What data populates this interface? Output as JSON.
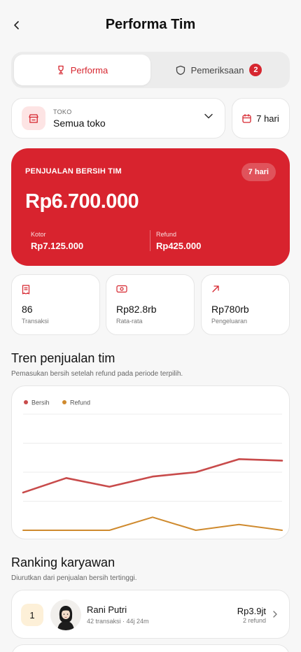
{
  "header": {
    "title": "Performa Tim"
  },
  "tabs": [
    {
      "label": "Performa",
      "icon": "trophy-icon",
      "active": true
    },
    {
      "label": "Pemeriksaan",
      "icon": "shield-icon",
      "badge": "2",
      "active": false
    }
  ],
  "filters": {
    "store_caption": "TOKO",
    "store_value": "Semua toko",
    "period": "7 hari"
  },
  "summary": {
    "label": "PENJUALAN BERSIH TIM",
    "period_pill": "7 hari",
    "net_amount": "Rp6.700.000",
    "gross_caption": "Kotor",
    "gross_value": "Rp7.125.000",
    "refund_caption": "Refund",
    "refund_value": "Rp425.000",
    "accent": "#d8232e"
  },
  "stats": [
    {
      "icon": "receipt-icon",
      "value": "86",
      "caption": "Transaksi"
    },
    {
      "icon": "cash-icon",
      "value": "Rp82.8rb",
      "caption": "Rata-rata"
    },
    {
      "icon": "arrow-up-right-icon",
      "value": "Rp780rb",
      "caption": "Pengeluaran"
    }
  ],
  "trend": {
    "title": "Tren penjualan tim",
    "subtitle": "Pemasukan bersih setelah refund pada periode terpilih."
  },
  "chart_data": {
    "type": "line",
    "title": "",
    "xlabel": "",
    "ylabel": "",
    "x": [
      1,
      2,
      3,
      4,
      5,
      6,
      7
    ],
    "grid": true,
    "legend": "top-left",
    "ylim": [
      0,
      4
    ],
    "series": [
      {
        "name": "Bersih",
        "color": "#c84b4b",
        "values": [
          1.3,
          1.8,
          1.5,
          1.85,
          2.0,
          2.45,
          2.4
        ]
      },
      {
        "name": "Refund",
        "color": "#cf8a2e",
        "values": [
          0.0,
          0.0,
          0.0,
          0.45,
          0.0,
          0.2,
          0.0
        ]
      }
    ]
  },
  "ranking": {
    "title": "Ranking karyawan",
    "subtitle": "Diurutkan dari penjualan bersih tertinggi.",
    "items": [
      {
        "rank": "1",
        "name": "Rani Putri",
        "meta": "42 transaksi · 44j 24m",
        "amount": "Rp3.9jt",
        "refund": "2 refund"
      }
    ]
  }
}
